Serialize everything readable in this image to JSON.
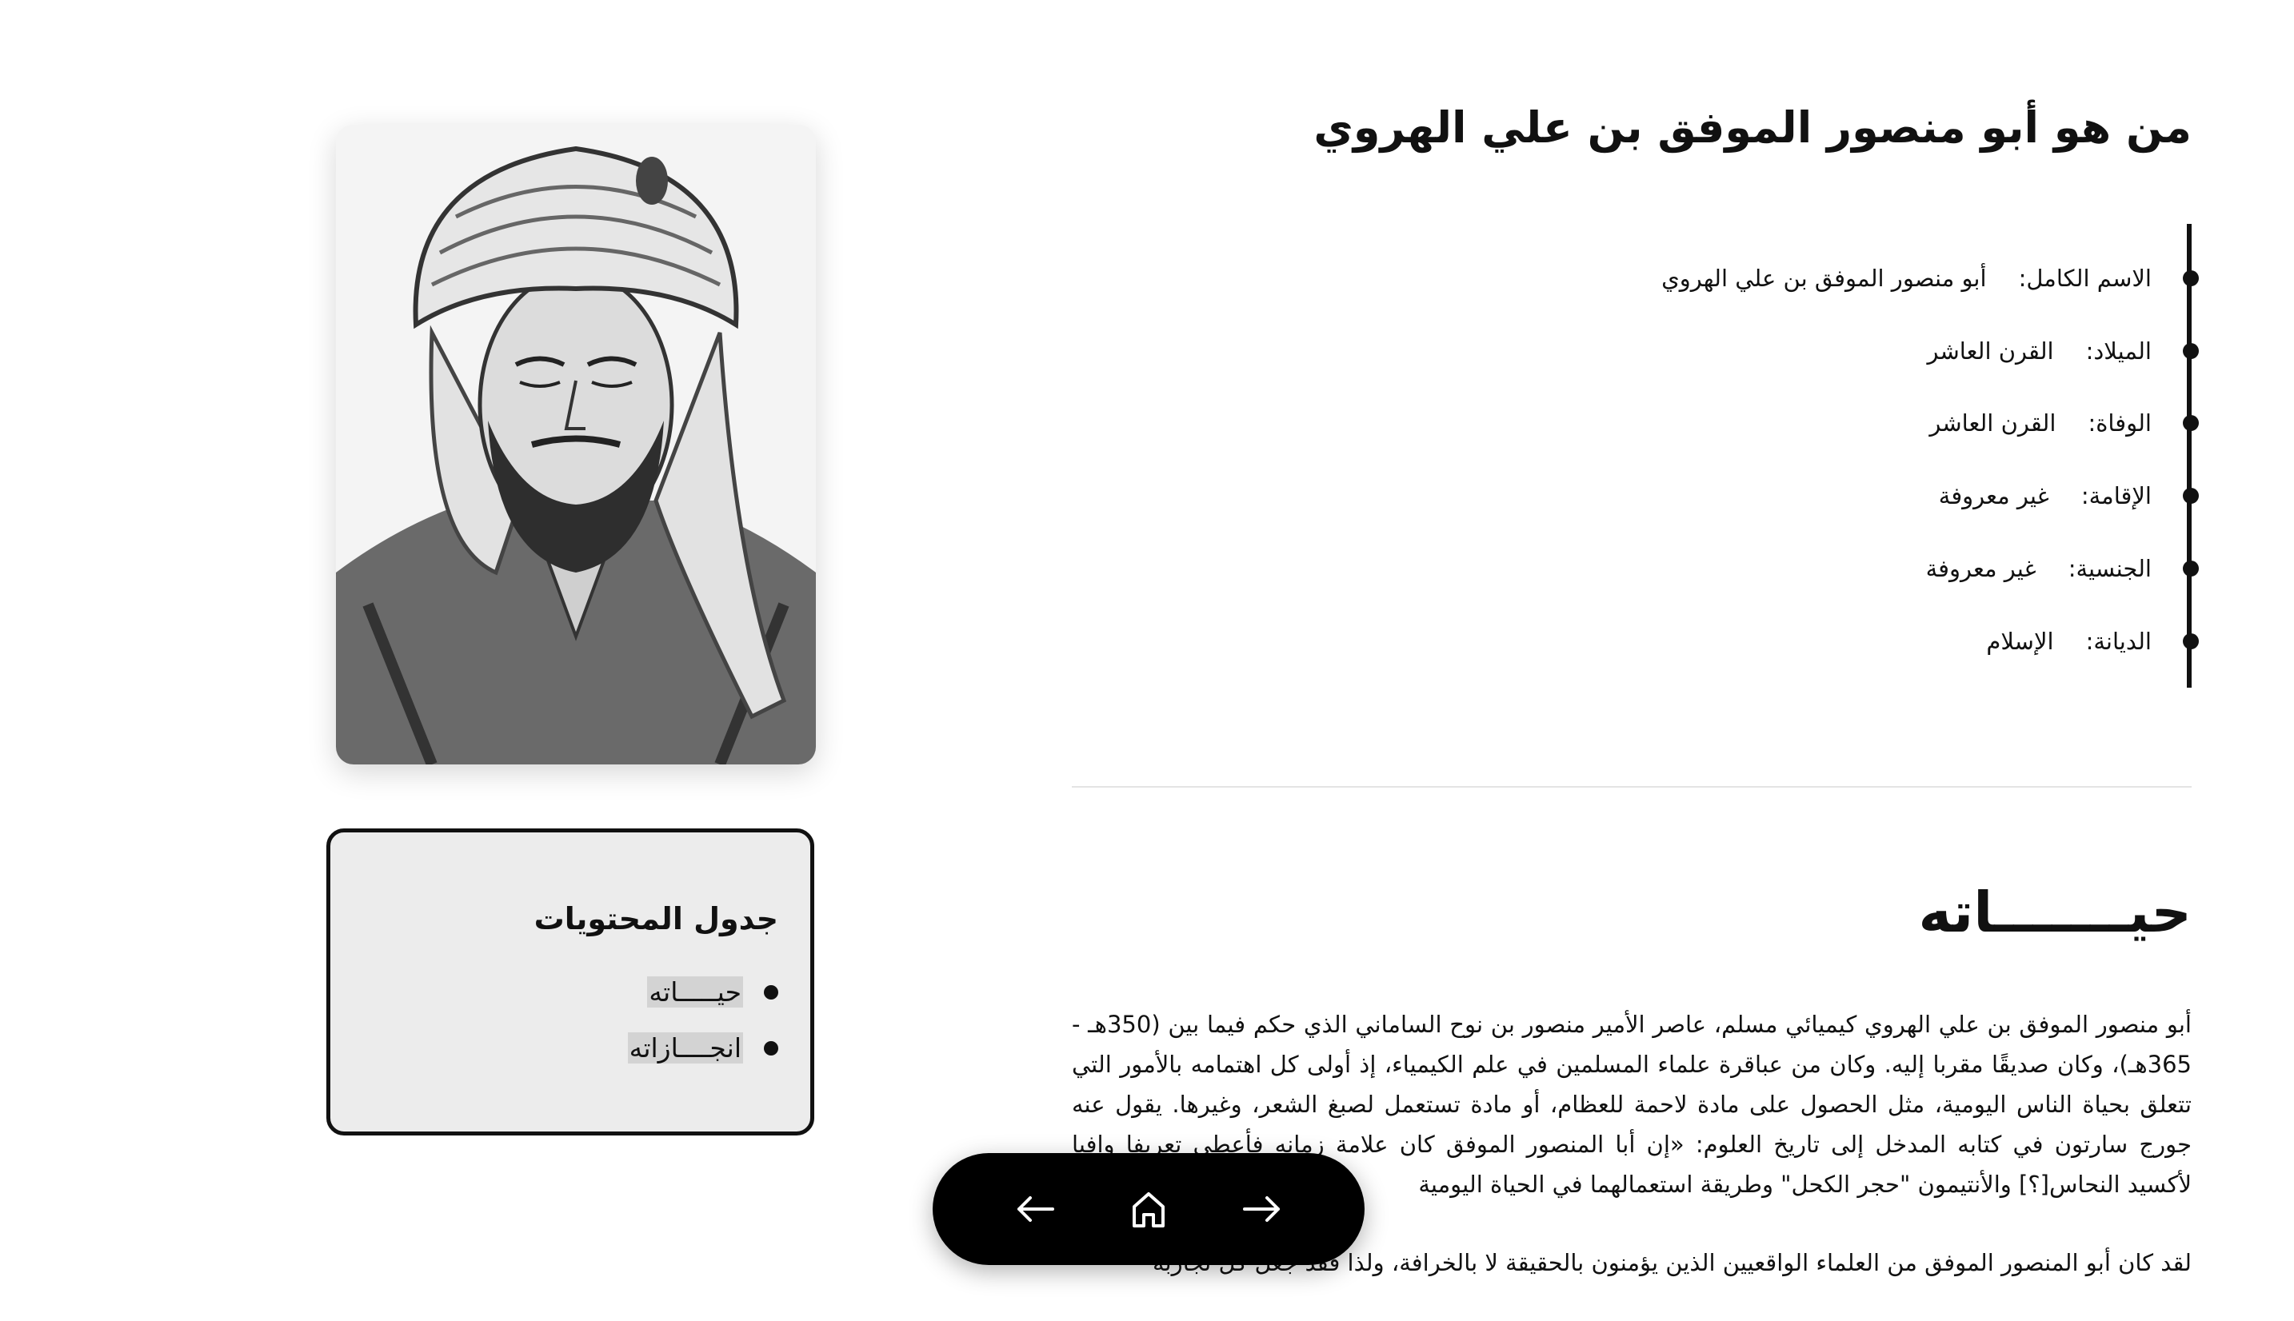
{
  "header": {
    "title": "من هو أبو منصور الموفق بن علي الهروي"
  },
  "info": [
    {
      "label": "الاسم الكامل:",
      "value": "أبو منصور الموفق بن علي الهروي"
    },
    {
      "label": "الميلاد:",
      "value": "القرن العاشر"
    },
    {
      "label": "الوفاة:",
      "value": "القرن العاشر"
    },
    {
      "label": "الإقامة:",
      "value": "غير معروفة"
    },
    {
      "label": "الجنسية:",
      "value": "غير معروفة"
    },
    {
      "label": "الديانة:",
      "value": "الإسلام"
    }
  ],
  "section": {
    "title": "حيـــــــاته",
    "paragraphs": [
      "أبو منصور الموفق بن علي الهروي كيميائي مسلم، عاصر الأمير منصور بن نوح الساماني الذي حكم فيما بين (350هـ - 365هـ)، وكان صديقًا مقربا إليه. وكان من عباقرة علماء المسلمين في علم الكيمياء، إذ أولى كل اهتمامه بالأمور التي تتعلق بحياة الناس اليومية، مثل الحصول على مادة لاحمة للعظام، أو مادة تستعمل لصبغ الشعر، وغيرها. يقول عنه جورج سارتون في كتابه المدخل إلى تاريخ العلوم: «إن أبا المنصور الموفق كان علامة زمانه فأعطى تعريفا وافيا لأكسيد النحاس[؟] والأنتيمون \"حجر الكحل\" وطريقة استعمالهما في الحياة اليومية",
      "لقد كان أبو المنصور الموفق من العلماء الواقعيين الذين يؤمنون بالحقيقة لا بالخرافة، ولذا فقد جعل كل تجاربه"
    ]
  },
  "toc": {
    "title": "جدول المحتويات",
    "items": [
      "حيـــــاته",
      "انجــــازاته"
    ]
  },
  "nav": {
    "icons": [
      "back-arrow-icon",
      "home-icon",
      "forward-arrow-icon"
    ]
  }
}
